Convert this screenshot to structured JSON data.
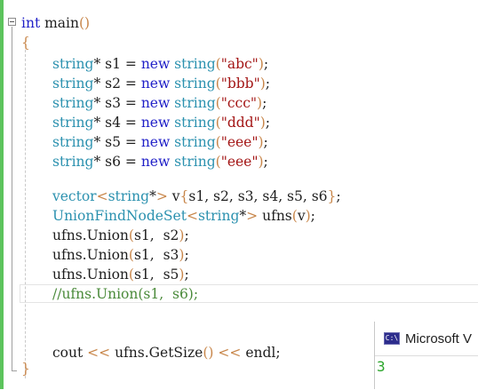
{
  "editor": {
    "lines": {
      "l1_kw": "int",
      "l1_fn": " main",
      "l1_paren": "()",
      "l2_brace": "{",
      "decl": [
        {
          "type": "string",
          "var": "* s1 = ",
          "kw": "new",
          "ctor": " string",
          "open": "(",
          "str": "\"abc\"",
          "close": ")",
          "end": ";"
        },
        {
          "type": "string",
          "var": "* s2 = ",
          "kw": "new",
          "ctor": " string",
          "open": "(",
          "str": "\"bbb\"",
          "close": ")",
          "end": ";"
        },
        {
          "type": "string",
          "var": "* s3 = ",
          "kw": "new",
          "ctor": " string",
          "open": "(",
          "str": "\"ccc\"",
          "close": ")",
          "end": ";"
        },
        {
          "type": "string",
          "var": "* s4 = ",
          "kw": "new",
          "ctor": " string",
          "open": "(",
          "str": "\"ddd\"",
          "close": ")",
          "end": ";"
        },
        {
          "type": "string",
          "var": "* s5 = ",
          "kw": "new",
          "ctor": " string",
          "open": "(",
          "str": "\"eee\"",
          "close": ")",
          "end": ";"
        },
        {
          "type": "string",
          "var": "* s6 = ",
          "kw": "new",
          "ctor": " string",
          "open": "(",
          "str": "\"eee\"",
          "close": ")",
          "end": ";"
        }
      ],
      "vec_type": "vector",
      "vec_lt": "<",
      "vec_inner": "string",
      "vec_star": "*",
      "vec_gt": ">",
      "vec_rest": " v",
      "vec_ob": "{",
      "vec_args": "s1, s2, s3, s4, s5, s6",
      "vec_cb": "}",
      "vec_end": ";",
      "uf_type": "UnionFindNodeSet",
      "uf_lt": "<",
      "uf_inner": "string",
      "uf_star": "*",
      "uf_gt": ">",
      "uf_rest": " ufns",
      "uf_op": "(",
      "uf_arg": "v",
      "uf_cp": ")",
      "uf_end": ";",
      "unions": [
        {
          "obj": "ufns.Union",
          "op": "(",
          "args": "s1,  s2",
          "cp": ")",
          "end": ";"
        },
        {
          "obj": "ufns.Union",
          "op": "(",
          "args": "s1,  s3",
          "cp": ")",
          "end": ";"
        },
        {
          "obj": "ufns.Union",
          "op": "(",
          "args": "s1,  s5",
          "cp": ")",
          "end": ";"
        }
      ],
      "comment": "//ufns.Union(s1,  s6);",
      "cout_a": "cout ",
      "cout_op1": "<<",
      "cout_b": " ufns.GetSize",
      "cout_p": "()",
      "cout_c": " ",
      "cout_op2": "<<",
      "cout_d": " endl;",
      "close_brace": "}"
    }
  },
  "console": {
    "icon_text": "C:\\",
    "title": "Microsoft V",
    "output": "3"
  },
  "colors": {
    "keyword": "#2020c8",
    "type": "#2b91af",
    "string": "#a31515",
    "comment": "#4a8a3a",
    "bracket": "#c8864a",
    "gutter_change": "#5cc45c",
    "console_output": "#2aa52a"
  }
}
